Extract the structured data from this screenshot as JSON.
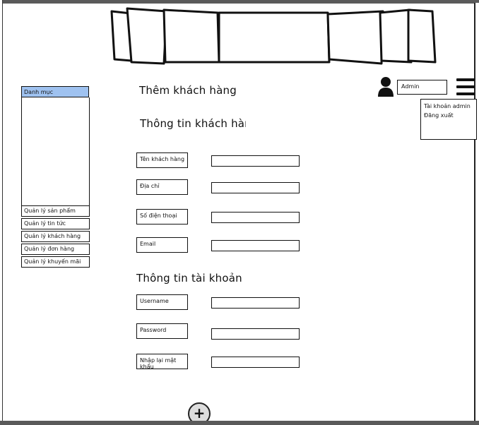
{
  "banner": {
    "icon": "sketch-image-carousel-icon"
  },
  "sidebar": {
    "header": "Danh mục",
    "items": [
      {
        "label": "Quản lý sản phẩm"
      },
      {
        "label": "Quản lý tin tức"
      },
      {
        "label": "Quản lý khách hàng"
      },
      {
        "label": "Quản lý đơn hàng"
      },
      {
        "label": "Quản lý khuyến mãi"
      }
    ]
  },
  "header": {
    "user_icon": "user-icon",
    "admin_label": "Admin",
    "menu_icon": "hamburger-menu-icon",
    "dropdown": [
      "Tài khoản admin",
      "Đăng xuất"
    ]
  },
  "page": {
    "title": "Thêm khách hàng",
    "section_customer": "Thông tin khách hàng",
    "section_account": "Thông tin tài khoản"
  },
  "customer_fields": [
    {
      "label": "Tên khách hàng",
      "value": ""
    },
    {
      "label": "Địa chỉ",
      "value": ""
    },
    {
      "label": "Số điện thoại",
      "value": ""
    },
    {
      "label": "Email",
      "value": ""
    }
  ],
  "account_fields": [
    {
      "label": "Username",
      "value": ""
    },
    {
      "label": "Password",
      "value": ""
    },
    {
      "label": "Nhập lại mật khẩu",
      "value": ""
    }
  ],
  "actions": {
    "add_label": "+",
    "add_icon": "plus-circle-icon"
  }
}
